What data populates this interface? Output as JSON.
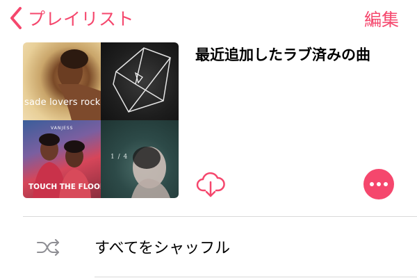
{
  "nav": {
    "back_label": "プレイリスト",
    "edit_label": "編集"
  },
  "playlist": {
    "title": "最近追加したラブ済みの曲",
    "covers": [
      {
        "text": "sade lovers rock"
      },
      {
        "text": ""
      },
      {
        "text": "TOUCH THE FLOOR",
        "top_text": "VANJESS"
      },
      {
        "text": "1 / 4"
      }
    ]
  },
  "actions": {
    "download_icon": "cloud-download-icon",
    "more_icon": "ellipsis-icon"
  },
  "list": {
    "shuffle_label": "すべてをシャッフル",
    "shuffle_icon": "shuffle-icon"
  },
  "colors": {
    "accent": "#f5476d",
    "separator": "#d9d9d9",
    "icon_gray": "#8e8e93"
  }
}
